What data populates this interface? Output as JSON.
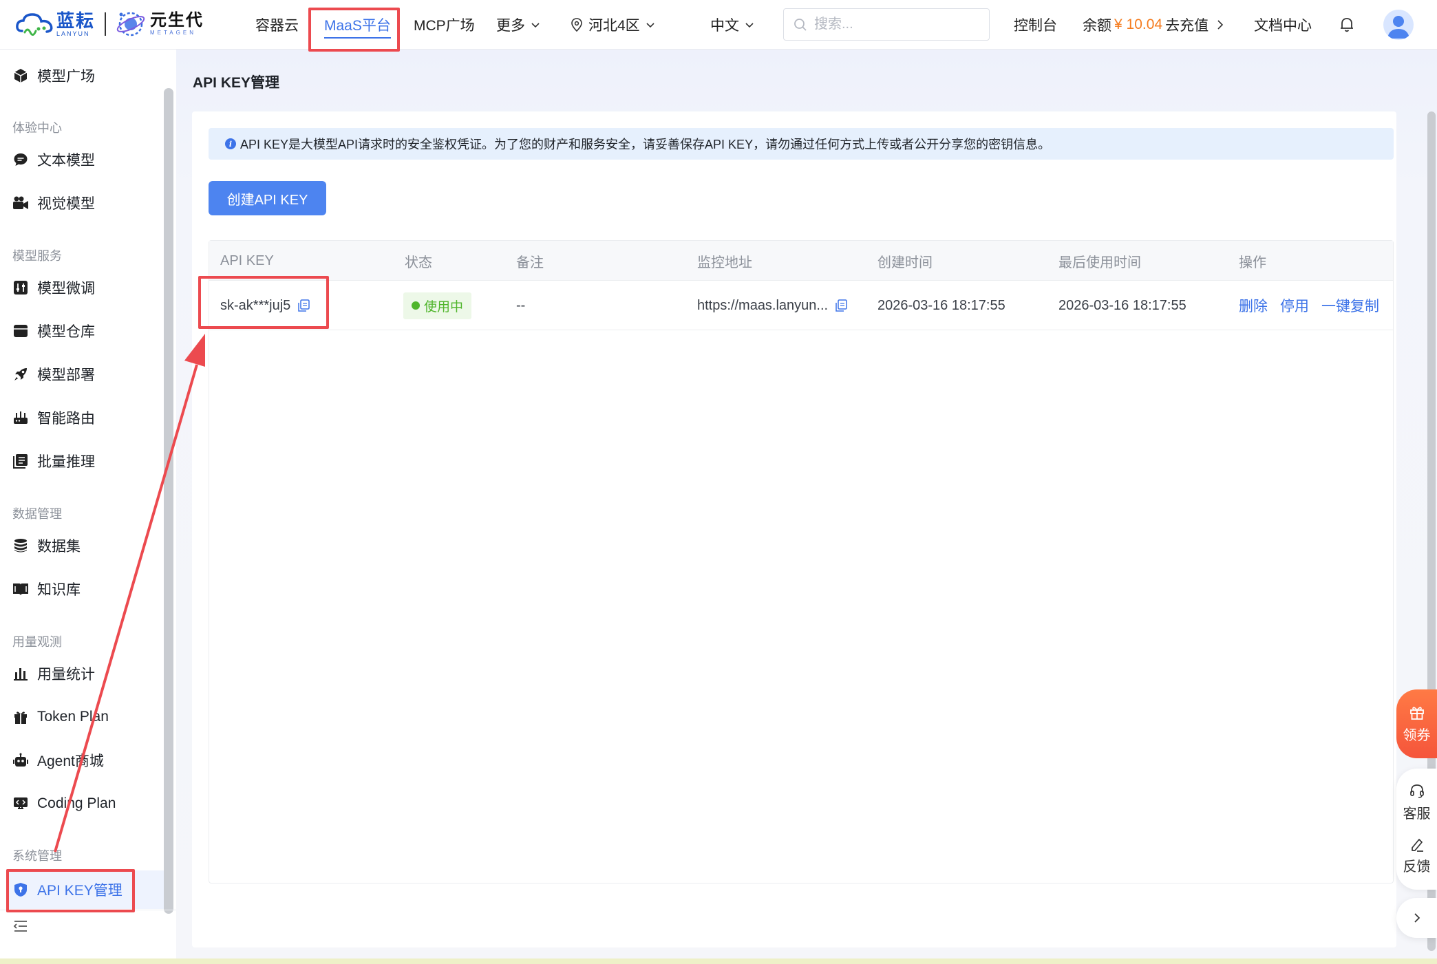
{
  "header": {
    "logo_lanyun_cn": "蓝耘",
    "logo_lanyun_en": "LANYUN",
    "logo_metagen_cn": "元生代",
    "logo_metagen_en": "METAGEN",
    "nav": {
      "container_cloud": "容器云",
      "maas_platform": "MaaS平台",
      "mcp_plaza": "MCP广场",
      "more": "更多",
      "region": "河北4区",
      "language": "中文"
    },
    "search_placeholder": "搜索...",
    "console": "控制台",
    "balance_label": "余额",
    "balance_amount": "¥ 10.04",
    "recharge": "去充值",
    "docs": "文档中心"
  },
  "sidebar": {
    "model_plaza": "模型广场",
    "group_experience": "体验中心",
    "text_model": "文本模型",
    "vision_model": "视觉模型",
    "group_model_service": "模型服务",
    "finetune": "模型微调",
    "model_repo": "模型仓库",
    "deploy": "模型部署",
    "routing": "智能路由",
    "batch": "批量推理",
    "group_data": "数据管理",
    "dataset": "数据集",
    "knowledge": "知识库",
    "group_usage": "用量观测",
    "usage_stats": "用量统计",
    "token_plan": "Token Plan",
    "agent_mall": "Agent商城",
    "coding_plan": "Coding Plan",
    "group_system": "系统管理",
    "api_key_mgmt": "API KEY管理"
  },
  "main": {
    "title": "API KEY管理",
    "alert": "API KEY是大模型API请求时的安全鉴权凭证。为了您的财产和服务安全，请妥善保存API KEY，请勿通过任何方式上传或者公开分享您的密钥信息。",
    "create_button": "创建API KEY",
    "table": {
      "headers": {
        "api_key": "API KEY",
        "status": "状态",
        "remark": "备注",
        "monitor_url": "监控地址",
        "created": "创建时间",
        "last_used": "最后使用时间",
        "actions": "操作"
      },
      "rows": [
        {
          "api_key": "sk-ak***juj5",
          "status": "使用中",
          "remark": "--",
          "monitor_url": "https://maas.lanyun...",
          "created": "2026-03-16 18:17:55",
          "last_used": "2026-03-16 18:17:55",
          "action_delete": "删除",
          "action_disable": "停用",
          "action_copy": "一键复制"
        }
      ]
    }
  },
  "floating": {
    "coupon": "领券",
    "service": "客服",
    "feedback": "反馈"
  },
  "colors": {
    "accent": "#3d73e8",
    "highlight_box": "#ec4a4f",
    "status_green": "#4fb52b",
    "balance_orange": "#f57c1f"
  }
}
